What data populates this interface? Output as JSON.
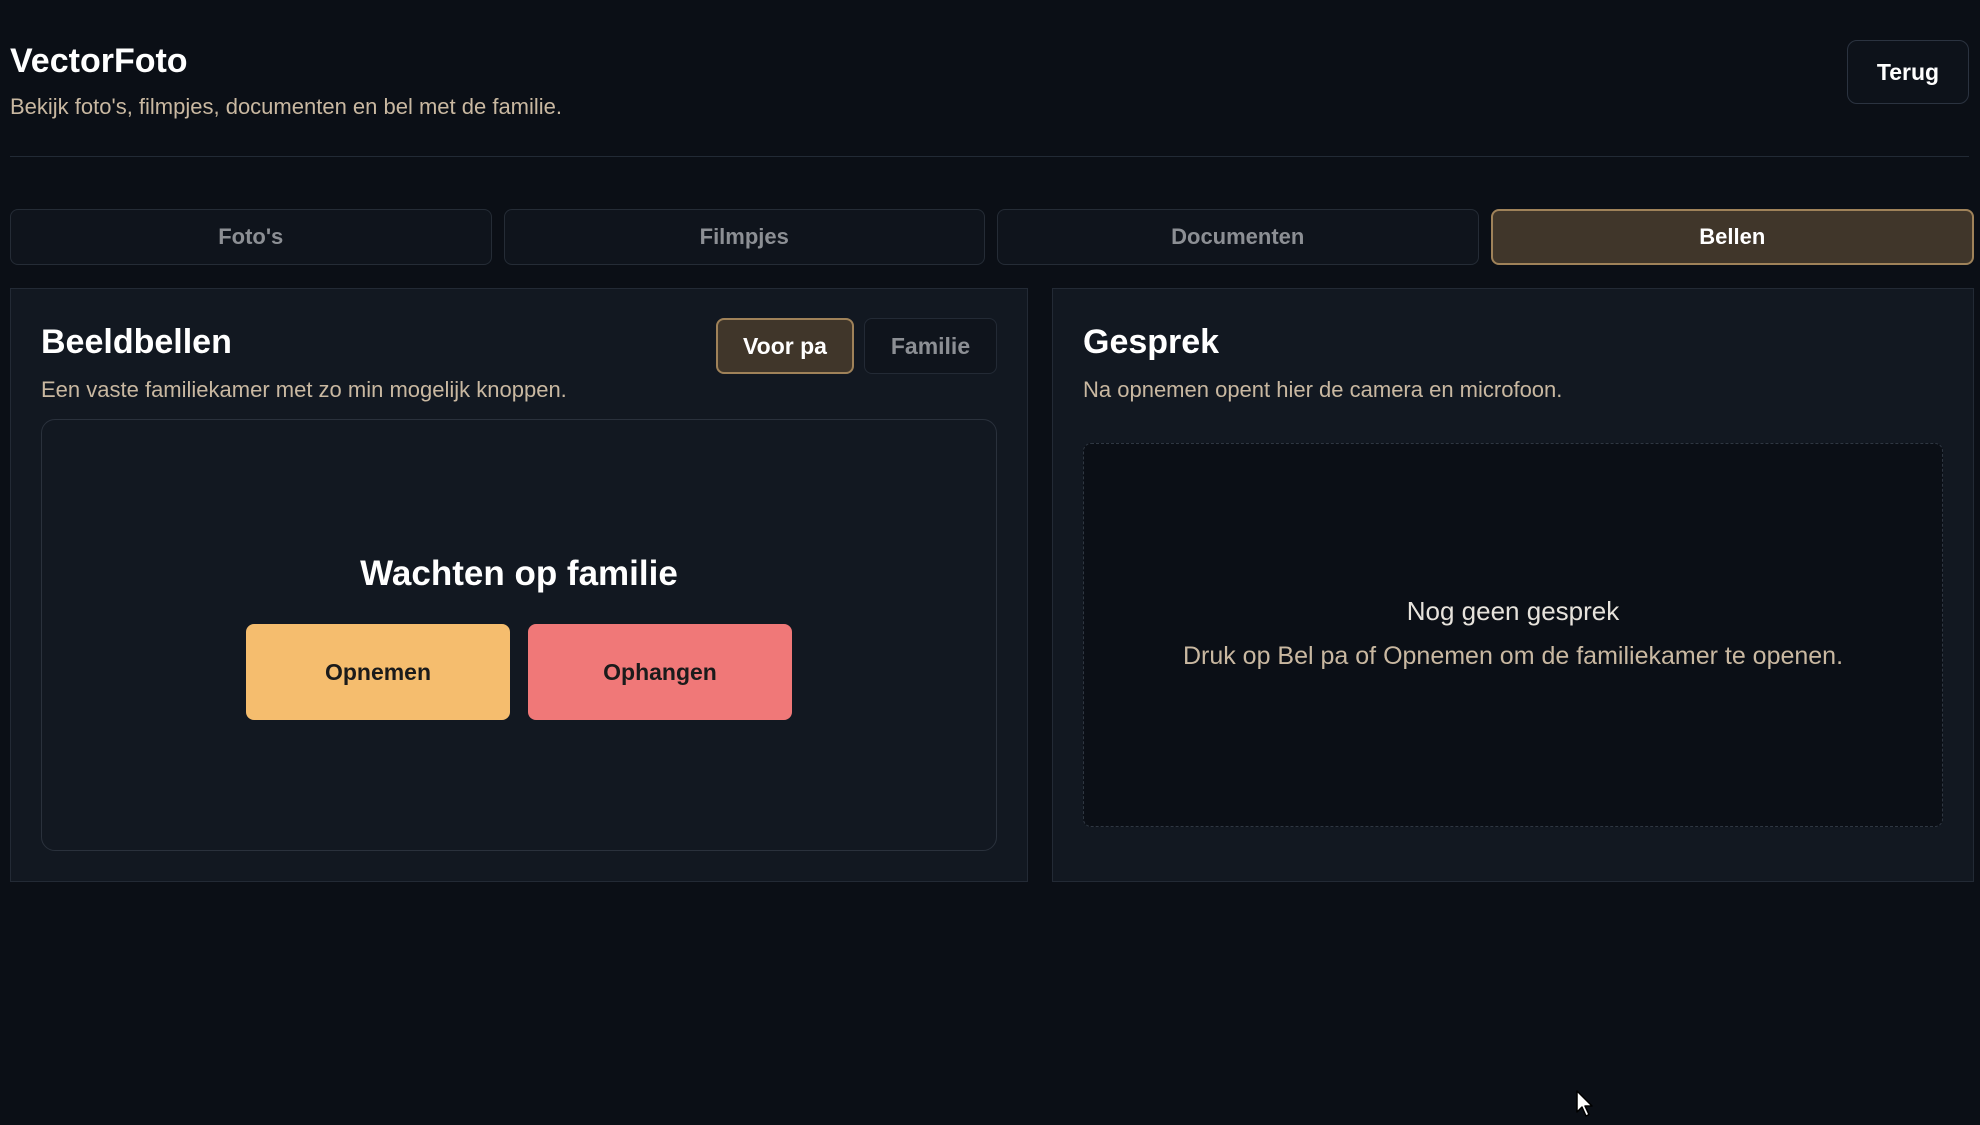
{
  "app": {
    "title": "VectorFoto",
    "subtitle": "Bekijk foto's, filmpjes, documenten en bel met de familie.",
    "back_label": "Terug"
  },
  "tabs": [
    {
      "label": "Foto's",
      "active": false
    },
    {
      "label": "Filmpjes",
      "active": false
    },
    {
      "label": "Documenten",
      "active": false
    },
    {
      "label": "Bellen",
      "active": true
    }
  ],
  "video_call": {
    "title": "Beeldbellen",
    "description": "Een vaste familiekamer met zo min mogelijk knoppen.",
    "modes": [
      {
        "label": "Voor pa",
        "active": true
      },
      {
        "label": "Familie",
        "active": false
      }
    ],
    "status": "Wachten op familie",
    "answer_label": "Opnemen",
    "hangup_label": "Ophangen"
  },
  "conversation": {
    "title": "Gesprek",
    "description": "Na opnemen opent hier de camera en microfoon.",
    "empty_title": "Nog geen gesprek",
    "empty_hint": "Druk op Bel pa of Opnemen om de familiekamer te openen."
  },
  "colors": {
    "background": "#0b0f16",
    "panel": "#121821",
    "accent_active": "#40362a",
    "accent_border": "#9f8259",
    "answer": "#f5bd6e",
    "hangup": "#f07878",
    "muted_text": "#c9b8a1"
  },
  "icons": {
    "cursor": "mouse-pointer-icon"
  }
}
